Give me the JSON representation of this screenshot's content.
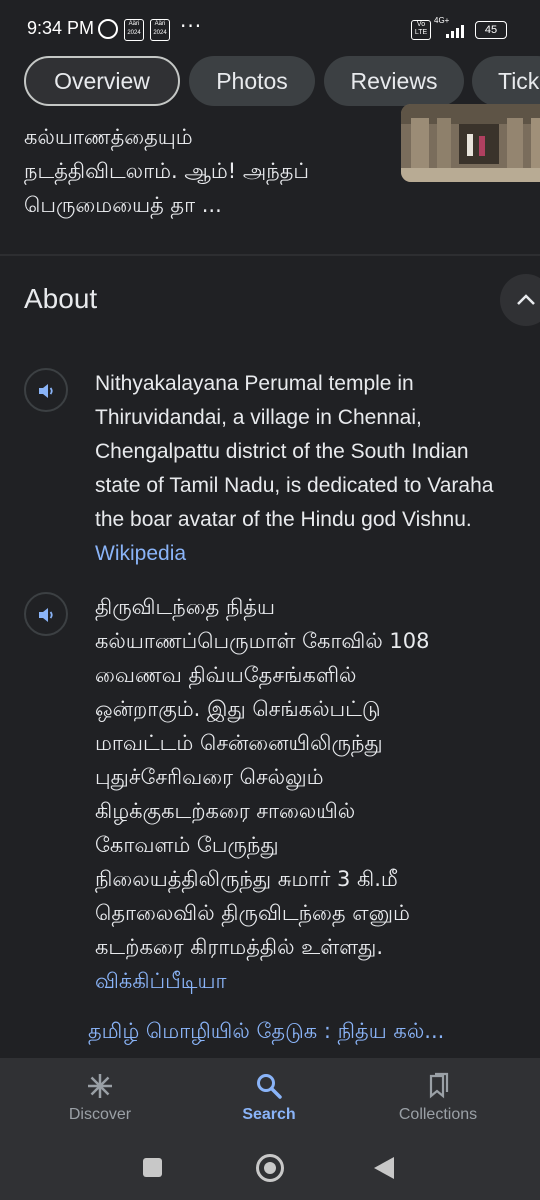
{
  "status_bar": {
    "time": "9:34 PM",
    "chip_text": "Ääri 2024",
    "overflow": "···",
    "volte": "Vo LTE",
    "network": "4G+",
    "battery": "45"
  },
  "tabs": [
    {
      "label": "Overview",
      "active": true
    },
    {
      "label": "Photos",
      "active": false
    },
    {
      "label": "Reviews",
      "active": false
    },
    {
      "label": "Tick",
      "active": false
    }
  ],
  "snippet": {
    "lines": [
      "கல்யாணத்தையும்",
      "நடத்திவிடலாம். ஆம்! அந்தப்",
      "பெருமையைத் தா ..."
    ]
  },
  "about": {
    "title": "About",
    "english": {
      "lines": [
        "Nithyakalayana Perumal temple in",
        "Thiruvidandai, a village in Chennai,",
        "Chengalpattu district of the South Indian",
        "state of Tamil Nadu, is dedicated to Varaha",
        "the boar avatar of the Hindu god Vishnu."
      ],
      "source": "Wikipedia"
    },
    "tamil": {
      "lines": [
        "திருவிடந்தை நித்ய",
        "கல்யாணப்பெருமாள் கோவில் 108",
        "வைணவ திவ்யதேசங்களில்",
        "ஒன்றாகும். இது செங்கல்பட்டு",
        "மாவட்டம் சென்னையிலிருந்து",
        "புதுச்சேரிவரை செல்லும்",
        "கிழக்குகடற்கரை சாலையில்",
        "கோவளம் பேருந்து",
        "நிலையத்திலிருந்து சுமார் 3 கி.மீ",
        "தொலைவில் திருவிடந்தை எனும்",
        "கடற்கரை கிராமத்தில் உள்ளது."
      ],
      "source": "விக்கிப்பீடியா"
    },
    "search_in_tamil": "தமிழ் மொழியில் தேடுக : நித்ய கல்..."
  },
  "bottom_nav": [
    {
      "label": "Discover",
      "icon": "asterisk-icon",
      "active": false
    },
    {
      "label": "Search",
      "icon": "search-icon",
      "active": true
    },
    {
      "label": "Collections",
      "icon": "collections-icon",
      "active": false
    }
  ],
  "colors": {
    "background": "#202124",
    "link": "#8ab4f8",
    "text": "#e8eaed",
    "nav_bg": "#303134"
  }
}
